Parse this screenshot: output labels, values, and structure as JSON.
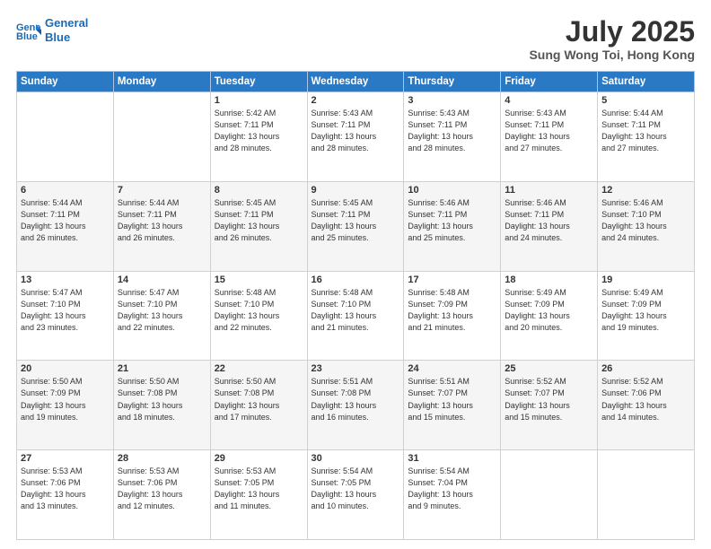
{
  "header": {
    "logo_line1": "General",
    "logo_line2": "Blue",
    "month_title": "July 2025",
    "location": "Sung Wong Toi, Hong Kong"
  },
  "weekdays": [
    "Sunday",
    "Monday",
    "Tuesday",
    "Wednesday",
    "Thursday",
    "Friday",
    "Saturday"
  ],
  "weeks": [
    [
      {
        "day": "",
        "info": ""
      },
      {
        "day": "",
        "info": ""
      },
      {
        "day": "1",
        "info": "Sunrise: 5:42 AM\nSunset: 7:11 PM\nDaylight: 13 hours\nand 28 minutes."
      },
      {
        "day": "2",
        "info": "Sunrise: 5:43 AM\nSunset: 7:11 PM\nDaylight: 13 hours\nand 28 minutes."
      },
      {
        "day": "3",
        "info": "Sunrise: 5:43 AM\nSunset: 7:11 PM\nDaylight: 13 hours\nand 28 minutes."
      },
      {
        "day": "4",
        "info": "Sunrise: 5:43 AM\nSunset: 7:11 PM\nDaylight: 13 hours\nand 27 minutes."
      },
      {
        "day": "5",
        "info": "Sunrise: 5:44 AM\nSunset: 7:11 PM\nDaylight: 13 hours\nand 27 minutes."
      }
    ],
    [
      {
        "day": "6",
        "info": "Sunrise: 5:44 AM\nSunset: 7:11 PM\nDaylight: 13 hours\nand 26 minutes."
      },
      {
        "day": "7",
        "info": "Sunrise: 5:44 AM\nSunset: 7:11 PM\nDaylight: 13 hours\nand 26 minutes."
      },
      {
        "day": "8",
        "info": "Sunrise: 5:45 AM\nSunset: 7:11 PM\nDaylight: 13 hours\nand 26 minutes."
      },
      {
        "day": "9",
        "info": "Sunrise: 5:45 AM\nSunset: 7:11 PM\nDaylight: 13 hours\nand 25 minutes."
      },
      {
        "day": "10",
        "info": "Sunrise: 5:46 AM\nSunset: 7:11 PM\nDaylight: 13 hours\nand 25 minutes."
      },
      {
        "day": "11",
        "info": "Sunrise: 5:46 AM\nSunset: 7:11 PM\nDaylight: 13 hours\nand 24 minutes."
      },
      {
        "day": "12",
        "info": "Sunrise: 5:46 AM\nSunset: 7:10 PM\nDaylight: 13 hours\nand 24 minutes."
      }
    ],
    [
      {
        "day": "13",
        "info": "Sunrise: 5:47 AM\nSunset: 7:10 PM\nDaylight: 13 hours\nand 23 minutes."
      },
      {
        "day": "14",
        "info": "Sunrise: 5:47 AM\nSunset: 7:10 PM\nDaylight: 13 hours\nand 22 minutes."
      },
      {
        "day": "15",
        "info": "Sunrise: 5:48 AM\nSunset: 7:10 PM\nDaylight: 13 hours\nand 22 minutes."
      },
      {
        "day": "16",
        "info": "Sunrise: 5:48 AM\nSunset: 7:10 PM\nDaylight: 13 hours\nand 21 minutes."
      },
      {
        "day": "17",
        "info": "Sunrise: 5:48 AM\nSunset: 7:09 PM\nDaylight: 13 hours\nand 21 minutes."
      },
      {
        "day": "18",
        "info": "Sunrise: 5:49 AM\nSunset: 7:09 PM\nDaylight: 13 hours\nand 20 minutes."
      },
      {
        "day": "19",
        "info": "Sunrise: 5:49 AM\nSunset: 7:09 PM\nDaylight: 13 hours\nand 19 minutes."
      }
    ],
    [
      {
        "day": "20",
        "info": "Sunrise: 5:50 AM\nSunset: 7:09 PM\nDaylight: 13 hours\nand 19 minutes."
      },
      {
        "day": "21",
        "info": "Sunrise: 5:50 AM\nSunset: 7:08 PM\nDaylight: 13 hours\nand 18 minutes."
      },
      {
        "day": "22",
        "info": "Sunrise: 5:50 AM\nSunset: 7:08 PM\nDaylight: 13 hours\nand 17 minutes."
      },
      {
        "day": "23",
        "info": "Sunrise: 5:51 AM\nSunset: 7:08 PM\nDaylight: 13 hours\nand 16 minutes."
      },
      {
        "day": "24",
        "info": "Sunrise: 5:51 AM\nSunset: 7:07 PM\nDaylight: 13 hours\nand 15 minutes."
      },
      {
        "day": "25",
        "info": "Sunrise: 5:52 AM\nSunset: 7:07 PM\nDaylight: 13 hours\nand 15 minutes."
      },
      {
        "day": "26",
        "info": "Sunrise: 5:52 AM\nSunset: 7:06 PM\nDaylight: 13 hours\nand 14 minutes."
      }
    ],
    [
      {
        "day": "27",
        "info": "Sunrise: 5:53 AM\nSunset: 7:06 PM\nDaylight: 13 hours\nand 13 minutes."
      },
      {
        "day": "28",
        "info": "Sunrise: 5:53 AM\nSunset: 7:06 PM\nDaylight: 13 hours\nand 12 minutes."
      },
      {
        "day": "29",
        "info": "Sunrise: 5:53 AM\nSunset: 7:05 PM\nDaylight: 13 hours\nand 11 minutes."
      },
      {
        "day": "30",
        "info": "Sunrise: 5:54 AM\nSunset: 7:05 PM\nDaylight: 13 hours\nand 10 minutes."
      },
      {
        "day": "31",
        "info": "Sunrise: 5:54 AM\nSunset: 7:04 PM\nDaylight: 13 hours\nand 9 minutes."
      },
      {
        "day": "",
        "info": ""
      },
      {
        "day": "",
        "info": ""
      }
    ]
  ]
}
